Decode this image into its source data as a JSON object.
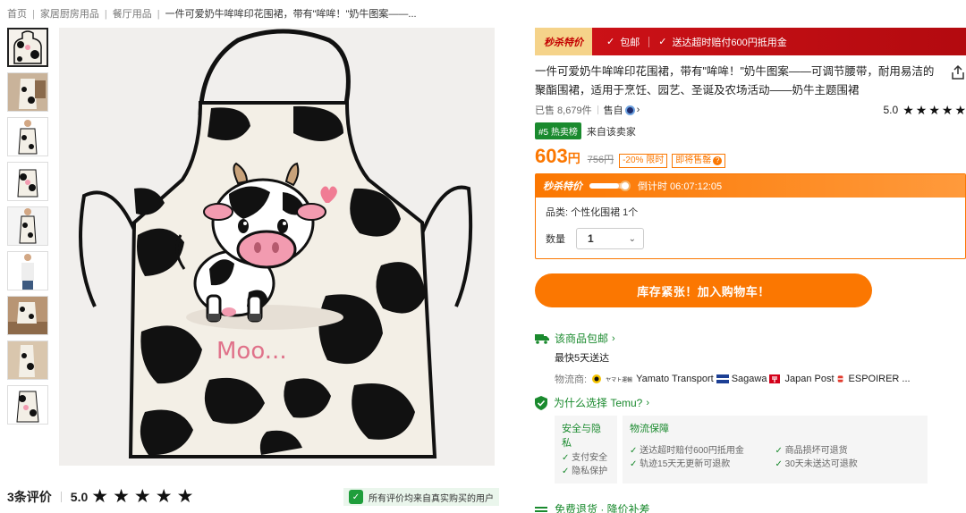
{
  "breadcrumb": {
    "items": [
      "首页",
      "家居厨房用品",
      "餐厅用品"
    ],
    "current": "一件可爱奶牛哞哞印花围裙，带有\"哞哞！\"奶牛图案——..."
  },
  "gallery": {
    "thumbnail_count": 9,
    "main_image_caption": "Moo..."
  },
  "reviews_bar": {
    "count_label": "3条评价",
    "score": "5.0",
    "stars": 5,
    "verified_text": "所有评价均来自真实购买的用户"
  },
  "promo_banner": {
    "flash_label": "秒杀特价",
    "item1": "包邮",
    "item2": "送达超时赔付600円抵用金"
  },
  "product": {
    "title": "一件可爱奶牛哞哞印花围裙，带有\"哞哞！\"奶牛图案——可调节腰带，耐用易洁的聚酯围裙，适用于烹饪、园艺、圣诞及农场活动——奶牛主题围裙",
    "sold": "已售 8,679件",
    "seller_label": "售自",
    "rating": "5.0",
    "rating_stars": 5,
    "bestseller_tag": "#5 热卖榜",
    "bestseller_text": "来自该卖家"
  },
  "price": {
    "current": "603",
    "unit": "円",
    "original": "756円",
    "discount_tag": "-20% 限时",
    "hot_tag": "即将售罄"
  },
  "flash_sale": {
    "label": "秒杀特价",
    "countdown": "倒计时 06:07:12:05",
    "progress": 0.82,
    "variant": "品类: 个性化围裙 1个",
    "quantity_label": "数量",
    "quantity_value": "1"
  },
  "cart_button": "库存紧张！加入购物车！",
  "shipping": {
    "title": "该商品包邮",
    "eta": "最快5天送达",
    "carriers_label": "物流商:",
    "carriers": [
      "Yamato Transport",
      "Sagawa",
      "Japan Post",
      "ESPOIRER ..."
    ],
    "yamato_logo_text": "ヤマト運輸"
  },
  "why_temu": {
    "title": "为什么选择 Temu?",
    "security": {
      "title": "安全与隐私",
      "items": [
        "支付安全",
        "隐私保护"
      ]
    },
    "logistics": {
      "title": "物流保障",
      "items": [
        "送达超时赔付600円抵用金",
        "轨迹15天无更新可退款",
        "商品损坏可退货",
        "30天未送达可退款"
      ]
    }
  },
  "returns": {
    "title": "免费退货 · 降价补差"
  },
  "colors": {
    "accent_orange": "#fb7701",
    "promo_red": "#c40f15",
    "green": "#1a8a2e"
  }
}
